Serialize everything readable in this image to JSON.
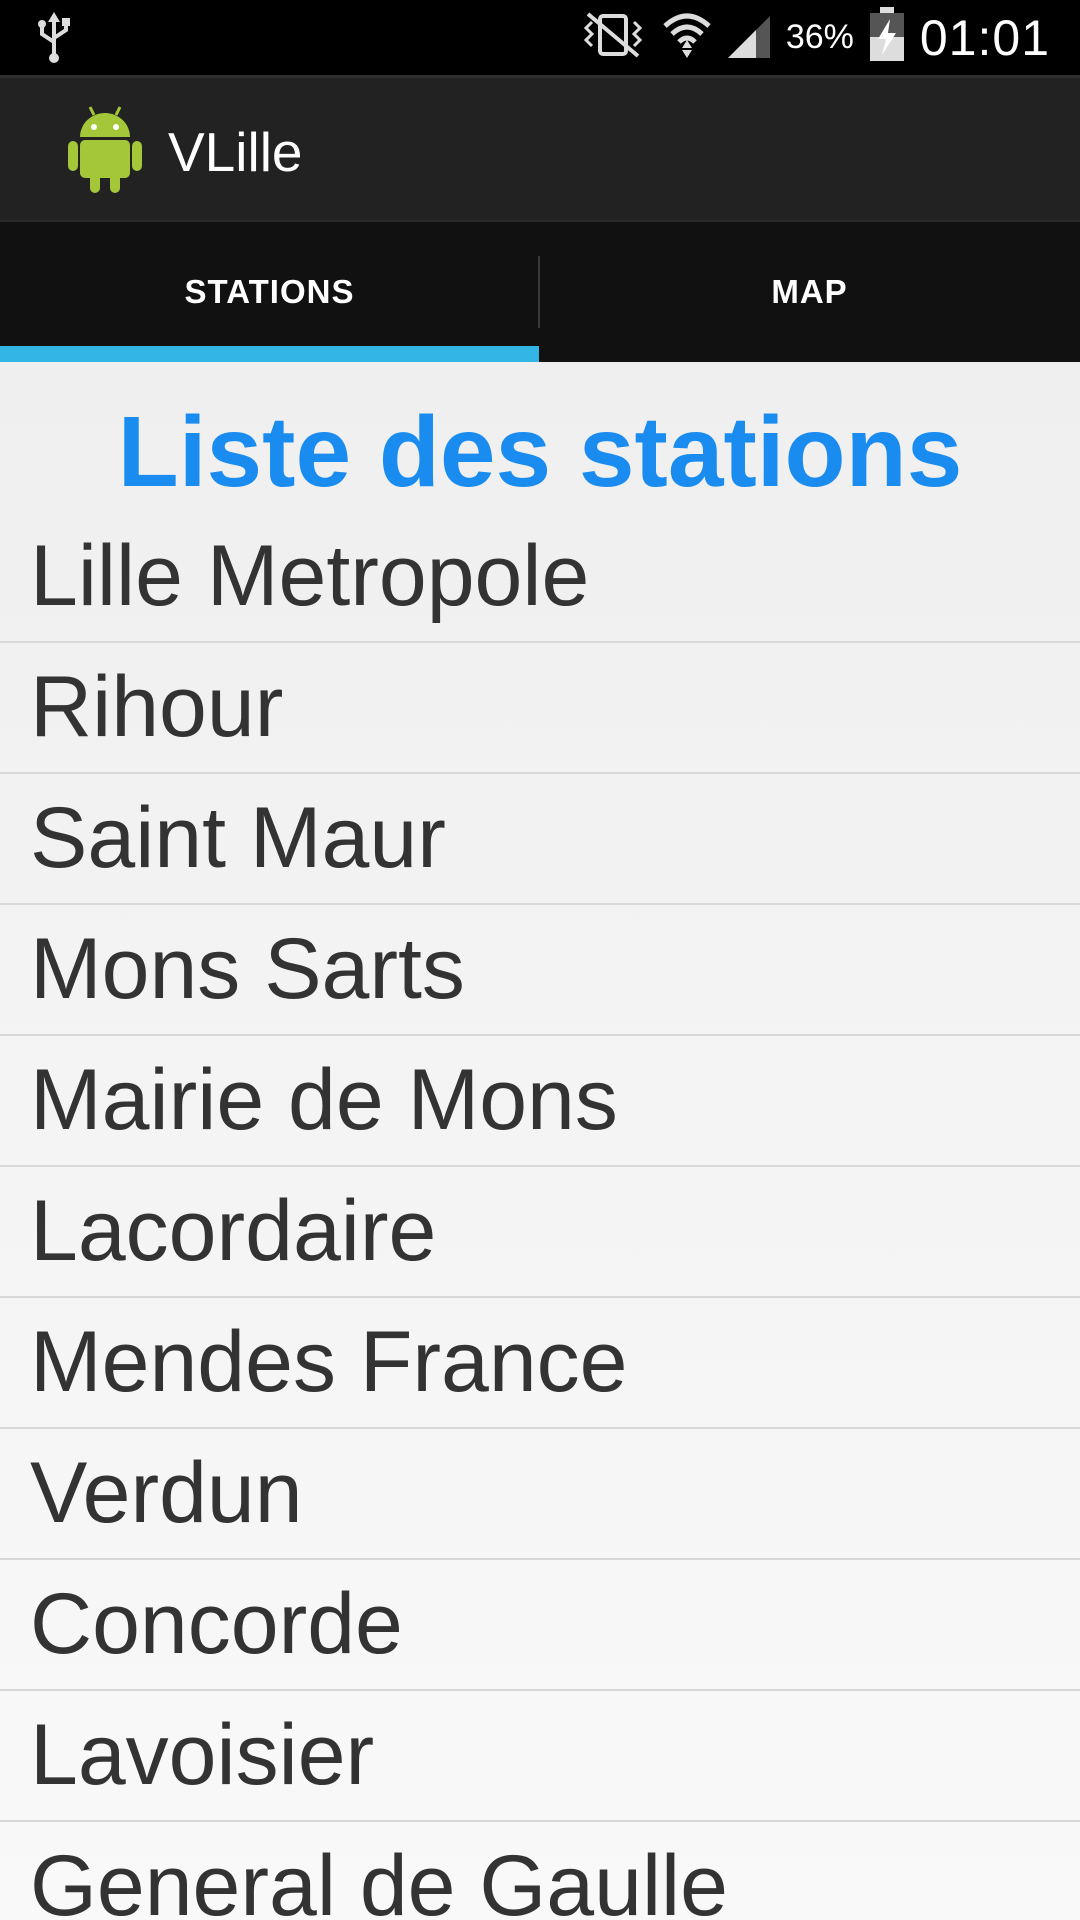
{
  "status_bar": {
    "icons": [
      "usb-icon",
      "vibrate-icon",
      "wifi-icon",
      "signal-icon",
      "battery-charging-icon"
    ],
    "battery_percent": "36%",
    "time": "01:01"
  },
  "action_bar": {
    "app_icon": "android-robot-icon",
    "title": "VLille"
  },
  "tabs": [
    {
      "label": "STATIONS",
      "selected": true
    },
    {
      "label": "MAP",
      "selected": false
    }
  ],
  "colors": {
    "accent": "#33b5e5",
    "title_blue": "#1a8cf0",
    "android_green": "#a4c639"
  },
  "main": {
    "title": "Liste des stations",
    "stations": [
      "Lille Metropole",
      "Rihour",
      "Saint Maur",
      "Mons Sarts",
      "Mairie de Mons",
      "Lacordaire",
      "Mendes France",
      "Verdun",
      "Concorde",
      "Lavoisier",
      "General de Gaulle"
    ]
  }
}
